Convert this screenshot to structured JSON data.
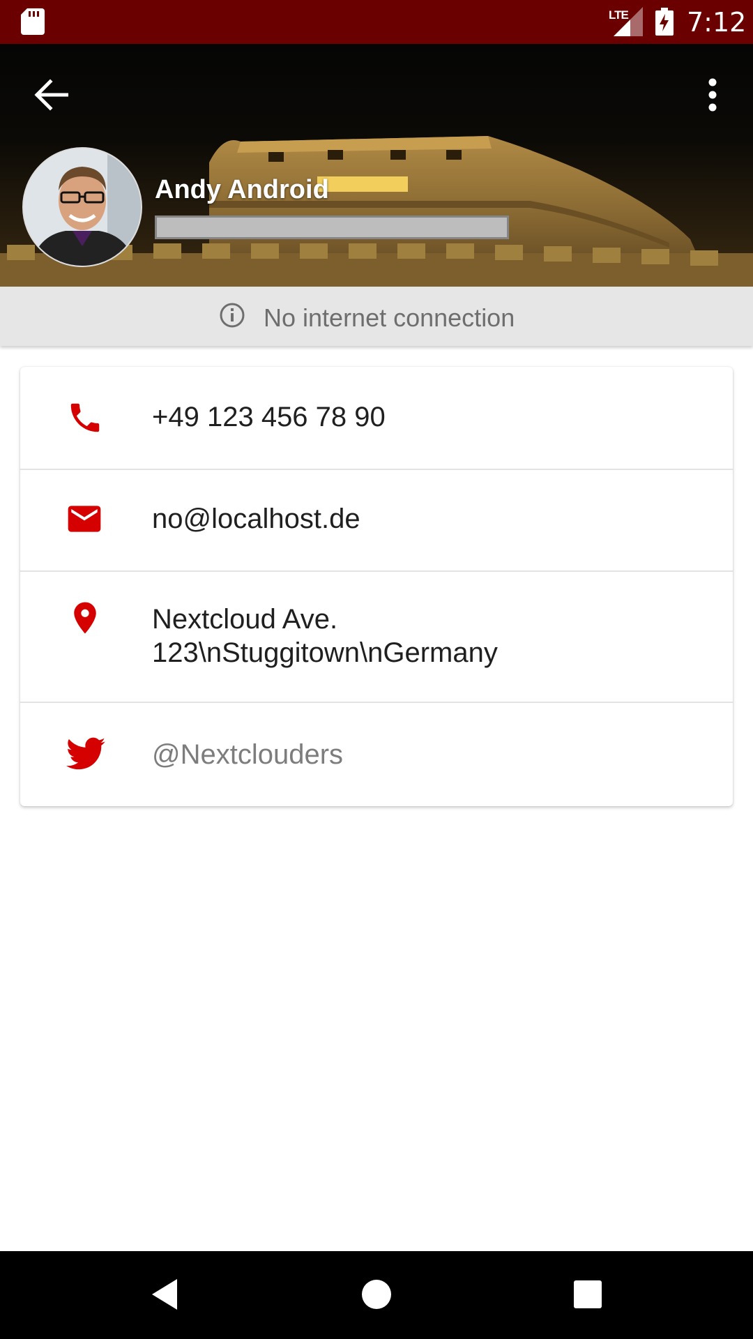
{
  "status_bar": {
    "time": "7:12",
    "network": "LTE",
    "icons": [
      "sd-card-icon",
      "signal-icon",
      "battery-charging-icon"
    ]
  },
  "header": {
    "back_icon": "back-arrow-icon",
    "menu_icon": "more-vert-icon",
    "contact_name": "Andy Android",
    "name_field_value": ""
  },
  "banner": {
    "icon": "info-icon",
    "text": "No internet connection"
  },
  "details": [
    {
      "icon": "phone-icon",
      "value": "+49 123 456 78 90"
    },
    {
      "icon": "email-icon",
      "value": "no@localhost.de"
    },
    {
      "icon": "location-icon",
      "line1": "Nextcloud Ave.",
      "line2": "123\\nStuggitown\\nGermany"
    },
    {
      "icon": "twitter-icon",
      "value": "@Nextclouders"
    }
  ],
  "colors": {
    "status_bar": "#6b0000",
    "accent": "#d50000",
    "banner_bg": "#e6e6e6"
  },
  "nav_bar": {
    "icons": [
      "nav-back-icon",
      "nav-home-icon",
      "nav-recents-icon"
    ]
  }
}
